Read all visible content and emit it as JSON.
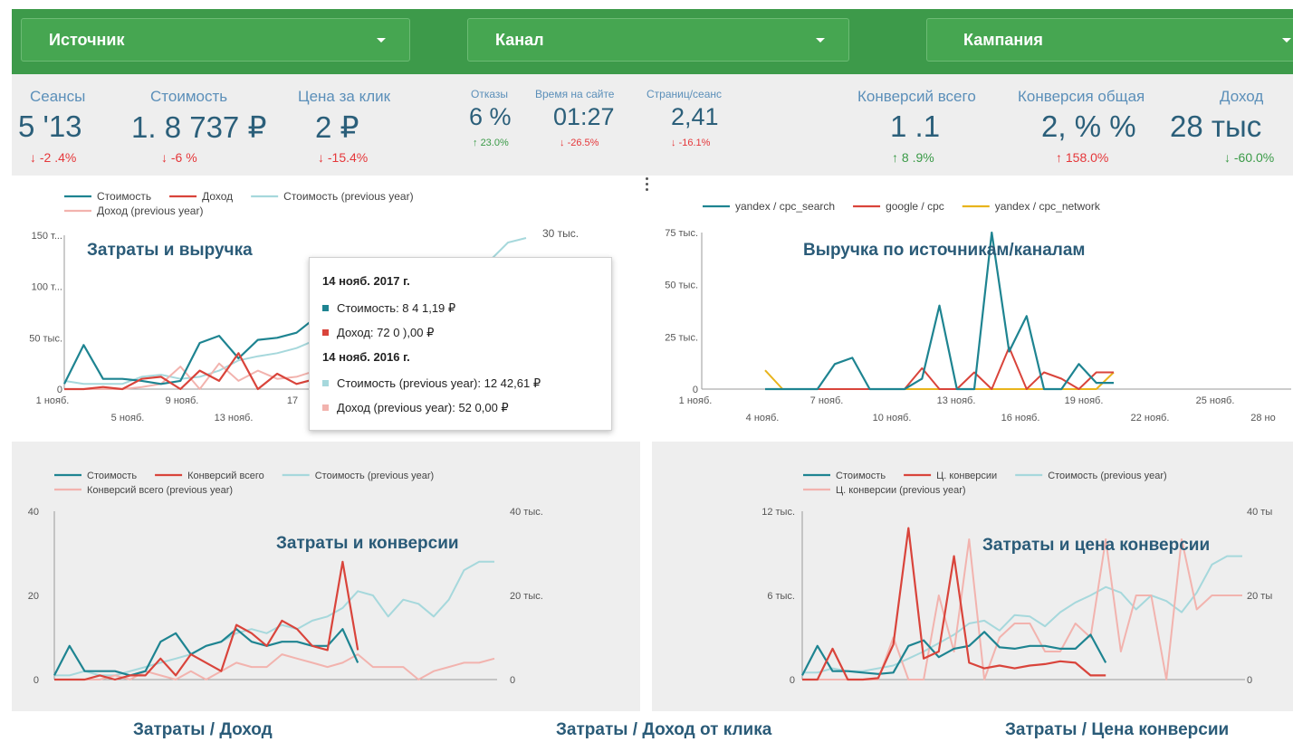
{
  "filters": [
    {
      "label": "Источник"
    },
    {
      "label": "Канал"
    },
    {
      "label": "Кампания"
    }
  ],
  "kpis": [
    {
      "label": "Сеансы",
      "value": "5 '13",
      "change": "-2 .4%",
      "dir": "down"
    },
    {
      "label": "Стоимость",
      "value": "1. 8 737 ₽",
      "change": "-6 %",
      "dir": "down"
    },
    {
      "label": "Цена за клик",
      "value": "2 ₽",
      "change": "-15.4%",
      "dir": "down"
    },
    {
      "label": "Отказы",
      "value": "6 %",
      "change": "23.0%",
      "dir": "up"
    },
    {
      "label": "Время на сайте",
      "value": "01:27",
      "change": "-26.5%",
      "dir": "down"
    },
    {
      "label": "Страниц/сеанс",
      "value": "2,41",
      "change": "-16.1%",
      "dir": "down"
    },
    {
      "label": "Конверсий всего",
      "value": "1 .1",
      "change": "8 .9%",
      "dir": "up"
    },
    {
      "label": "Конверсия общая",
      "value": "2, % %",
      "change": "158.0%",
      "dir": "up"
    },
    {
      "label": "Доход",
      "value": "28 тыс",
      "change": "-60.0%",
      "dir": "down"
    }
  ],
  "colors": {
    "cost": "#1e8491",
    "revenue": "#d9443b",
    "cost_prev": "#a6d8dc",
    "revenue_prev": "#f2b3ae",
    "network": "#e8b41c"
  },
  "tooltip": {
    "date1": "14 нояб. 2017 г.",
    "row1": "Стоимость: 8 4 1,19 ₽",
    "row2": "Доход: 72 0 ),00 ₽",
    "date2": "14 нояб. 2016 г.",
    "row3": "Стоимость (previous year): 12 42,61 ₽",
    "row4": "Доход (previous year): 52 0,00 ₽"
  },
  "footer": [
    "Затраты / Доход",
    "Затраты / Доход от клика",
    "Затраты / Цена конверсии"
  ],
  "chart_data": [
    {
      "type": "line",
      "title": "Затраты и выручка",
      "x_ticks_upper": [
        "1 нояб.",
        "9 нояб.",
        "17"
      ],
      "x_ticks_lower": [
        "5 нояб.",
        "13 нояб."
      ],
      "y_left_ticks": [
        "150 т...",
        "100 т...",
        "50 тыс.",
        "0"
      ],
      "y_right_ticks": [
        "30 тыс."
      ],
      "series": [
        {
          "name": "Стоимость",
          "values": [
            5,
            43,
            10,
            10,
            8,
            5,
            8,
            45,
            52,
            30,
            48,
            50,
            55,
            70,
            42,
            50,
            45
          ]
        },
        {
          "name": "Доход",
          "values": [
            0,
            0,
            2,
            0,
            10,
            12,
            0,
            18,
            8,
            35,
            0,
            15,
            5,
            10,
            72,
            40,
            30
          ]
        },
        {
          "name": "Стоимость (previous year)",
          "values": [
            8,
            5,
            5,
            5,
            12,
            14,
            10,
            12,
            18,
            28,
            32,
            35,
            40,
            48,
            60,
            55,
            62
          ]
        },
        {
          "name": "Доход (previous year)",
          "values": [
            0,
            0,
            0,
            0,
            2,
            5,
            22,
            0,
            25,
            8,
            18,
            10,
            12,
            18,
            52,
            30,
            20
          ]
        }
      ],
      "ylim": [
        0,
        150
      ]
    },
    {
      "type": "line",
      "title": "Выручка по источникам/каналам",
      "x_ticks_upper": [
        "1 нояб.",
        "7 нояб.",
        "13 нояб.",
        "19 нояб.",
        "25 нояб."
      ],
      "x_ticks_lower": [
        "4 нояб.",
        "10 нояб.",
        "16 нояб.",
        "22 нояб.",
        "28 но"
      ],
      "y_left_ticks": [
        "75 тыс.",
        "50 тыс.",
        "25 тыс.",
        "0"
      ],
      "series": [
        {
          "name": "yandex / cpc_search",
          "values": [
            0,
            0,
            0,
            0,
            12,
            15,
            0,
            0,
            0,
            5,
            40,
            0,
            0,
            75,
            18,
            35,
            0,
            0,
            12,
            3,
            3
          ]
        },
        {
          "name": "google / cpc",
          "values": [
            0,
            0,
            0,
            0,
            0,
            0,
            0,
            0,
            0,
            10,
            0,
            0,
            8,
            0,
            20,
            0,
            8,
            5,
            0,
            8,
            8
          ]
        },
        {
          "name": "yandex / cpc_network",
          "values": [
            9,
            0,
            0,
            0,
            0,
            0,
            0,
            0,
            0,
            0,
            0,
            0,
            0,
            0,
            0,
            0,
            0,
            0,
            0,
            0,
            8
          ]
        }
      ],
      "ylim": [
        0,
        75
      ]
    },
    {
      "type": "line",
      "title": "Затраты и конверсии",
      "y_left_ticks": [
        "40",
        "20",
        "0"
      ],
      "y_right_ticks": [
        "40 тыс.",
        "20 тыс.",
        "0"
      ],
      "series": [
        {
          "name": "Стоимость",
          "values": [
            1,
            8,
            2,
            2,
            2,
            1,
            2,
            9,
            11,
            6,
            8,
            9,
            12,
            9,
            8,
            9,
            9,
            8,
            8,
            12,
            4
          ]
        },
        {
          "name": "Конверсий всего",
          "values": [
            0,
            0,
            0,
            1,
            0,
            1,
            1,
            5,
            1,
            6,
            4,
            2,
            13,
            11,
            8,
            14,
            12,
            8,
            7,
            28,
            7
          ]
        },
        {
          "name": "Стоимость (previous year)",
          "values": [
            1,
            1,
            2,
            1,
            1,
            2,
            3,
            4,
            5,
            6,
            8,
            9,
            11,
            12,
            11,
            13,
            12,
            14,
            15,
            17,
            21,
            20,
            15,
            19,
            18,
            15,
            19,
            26,
            28,
            28
          ]
        },
        {
          "name": "Конверсий всего (previous year)",
          "values": [
            0,
            0,
            0,
            0,
            1,
            0,
            2,
            1,
            0,
            2,
            0,
            2,
            4,
            3,
            3,
            6,
            5,
            4,
            3,
            4,
            6,
            3,
            3,
            3,
            0,
            2,
            3,
            4,
            4,
            5
          ]
        }
      ],
      "ylim": [
        0,
        40
      ]
    },
    {
      "type": "line",
      "title": "Затраты и цена конверсии",
      "y_left_ticks": [
        "12 тыс.",
        "6 тыс.",
        "0"
      ],
      "y_right_ticks": [
        "40 ты",
        "20 ты",
        "0"
      ],
      "series": [
        {
          "name": "Стоимость",
          "values": [
            0.3,
            2.4,
            0.6,
            0.6,
            0.5,
            0.4,
            0.5,
            2.4,
            2.8,
            1.6,
            2.2,
            2.4,
            3.4,
            2.3,
            2.2,
            2.4,
            2.4,
            2.2,
            2.2,
            3.2,
            1.2
          ]
        },
        {
          "name": "Ц. конверсии",
          "values": [
            0,
            0,
            2.2,
            0,
            0,
            0.1,
            2.5,
            10.8,
            1.5,
            2,
            8.8,
            1.2,
            0.8,
            1.0,
            0.8,
            1.0,
            1.1,
            1.3,
            1.2,
            0.3,
            0.3
          ]
        },
        {
          "name": "Ц. конверсии (previous year)",
          "values": [
            0,
            0,
            0,
            0,
            0,
            0,
            3,
            0,
            0,
            6,
            2,
            10,
            0,
            3,
            4,
            4,
            2,
            2,
            4,
            3,
            10,
            2,
            6,
            6,
            0,
            10,
            5,
            6,
            6,
            6
          ]
        },
        {
          "name": "Ц. конверсии (previous year)",
          "values": [
            0.5,
            0.5,
            0.8,
            0.6,
            0.6,
            0.8,
            1,
            1.5,
            2,
            2.6,
            3.2,
            4,
            4.2,
            3.5,
            4.6,
            4.5,
            3.8,
            4.8,
            5.5,
            6,
            6.6,
            6.2,
            5,
            6,
            5.6,
            4.8,
            6.2,
            8.2,
            8.8,
            8.8
          ]
        }
      ],
      "ylim": [
        0,
        12
      ]
    }
  ]
}
